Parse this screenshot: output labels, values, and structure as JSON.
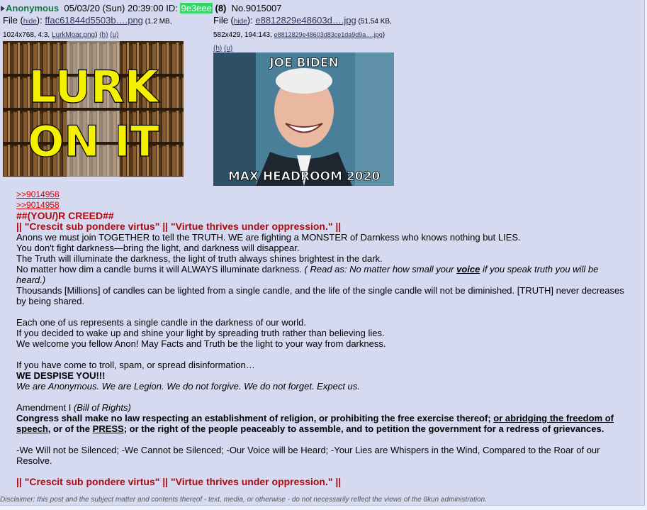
{
  "post": {
    "name": "Anonymous",
    "date": "05/03/20 (Sun) 20:39:00",
    "id_label": "ID:",
    "id_value": "9e3eee",
    "reply_count": "(8)",
    "post_no": "No.9015007"
  },
  "files": [
    {
      "prefix": "File (",
      "hide": "hide",
      "mid": "): ",
      "filename": "ffac61844d5503b….png",
      "meta_a": " (1.2 MB,",
      "meta_b": "1024x768, 4:3, ",
      "orig": "LurkMoar.png",
      "h": "(h)",
      "u": "(u)",
      "image_text_top": "LURK",
      "image_text_bottom": "ON IT"
    },
    {
      "prefix": "File (",
      "hide": "hide",
      "mid": "): ",
      "filename": "e8812829e48603d….jpg",
      "meta_a": " (51.54 KB,",
      "meta_b": "582x429, 194:143, ",
      "orig": "e8812829e48603d83ce1da9d9a….jpg",
      "h": "(h)",
      "u": "(u)",
      "image_text_top": "JOE BIDEN",
      "image_text_bottom": "MAX HEADROOM 2020"
    }
  ],
  "body": {
    "quote1": ">>9014958",
    "quote2": ">>9014958",
    "heading1": "##(YOU/)R CREED##",
    "heading2": "|| \"Crescit sub pondere virtus\" || \"Virtue thrives under oppression.\" ||",
    "p1": "Anons we must join TOGETHER to tell the TRUTH. WE are fighting a MONSTER of Darnkess who knows nothing but LIES.",
    "p2": "You don't fight darkness—bring the light, and darkness will disappear.",
    "p3": "The Truth will illuminate the darkness, the light of truth always shines brightest in the dark.",
    "p4a": "No matter how dim a candle burns it will ALWAYS illuminate darkness. ",
    "p4b": "( Read as: No matter how small your ",
    "p4c": "voice",
    "p4d": " if you speak truth you will be heard.)",
    "p5": "Thousands [Millions] of candles can be lighted from a single candle, and the life of the single candle will not be diminished. [TRUTH] never decreases by being shared.",
    "p6": "Each one of us represents a single candle in the darkness of our world.",
    "p7": "If you decided to wake up and shine your light by spreading truth rather than believing lies.",
    "p8": "We welcome you fellow Anon! May Facts and Truth be the light to your way from darkness.",
    "p9": "If you have come to troll, spam, or spread disinformation…",
    "p10": "WE DESPISE YOU!!!",
    "p11": "We are Anonymous. We are Legion. We do not forgive. We do not forget. Expect us.",
    "p12a": "Amendment I ",
    "p12b": "(Bill of Rights)",
    "p13a": "Congress shall make no law respecting an establishment of religion, or prohibiting the free exercise thereof; ",
    "p13b": "or abridging the freedom of speech",
    "p13c": ", or of the ",
    "p13d": "PRESS",
    "p13e": "; or the right of the people peaceably to assemble, and to petition the government for a redress of grievances.",
    "p14": "-We Will not be Silenced;  -We Cannot be Silenced;  -Our Voice will be Heard;   -Your Lies are Whispers in the Wind, Compared to the Roar of our Resolve.",
    "heading3": "|| \"Crescit sub pondere virtus\" || \"Virtue thrives under oppression.\" ||"
  },
  "disclaimer": "Disclaimer: this post and the subject matter and contents thereof - text, media, or otherwise - do not necessarily reflect the views of the 8kun administration."
}
